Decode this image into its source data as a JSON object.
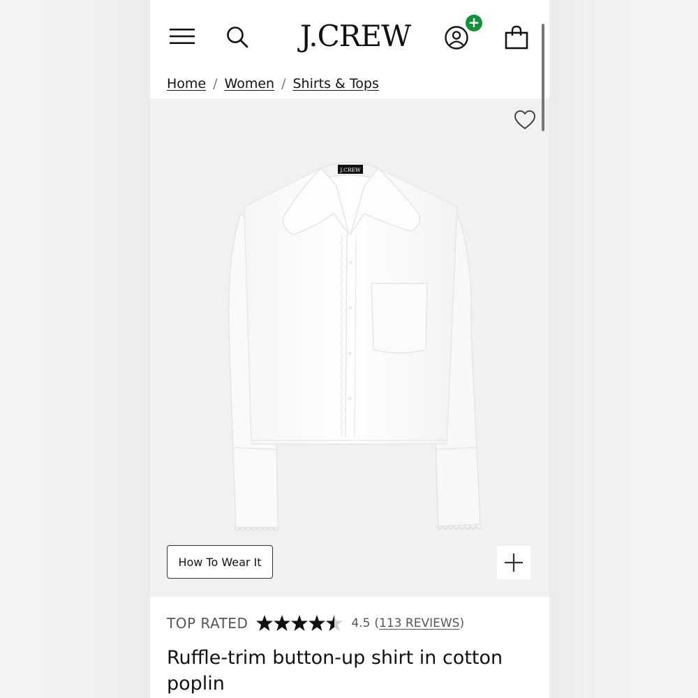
{
  "header": {
    "logo_text": "J.CREW",
    "account_badge": "+"
  },
  "breadcrumb": {
    "items": [
      "Home",
      "Women",
      "Shirts & Tops"
    ],
    "separator": "/"
  },
  "product": {
    "how_to_wear_label": "How To Wear It",
    "top_rated_label": "TOP RATED",
    "rating_value": "4.5",
    "rating_numeric": 4.5,
    "reviews_open": "(",
    "reviews_text": "113 REVIEWS",
    "reviews_close": ")",
    "title": "Ruffle-trim button-up shirt in cotton poplin",
    "shirt_label_text": "J.CREW"
  },
  "colors": {
    "badge_green": "#13923a",
    "hero_background": "#f1f1f1",
    "text_primary": "#111111",
    "text_secondary": "#555555"
  },
  "icons": [
    "menu-icon",
    "search-icon",
    "account-icon",
    "bag-icon",
    "heart-icon",
    "plus-icon",
    "star-icon"
  ]
}
